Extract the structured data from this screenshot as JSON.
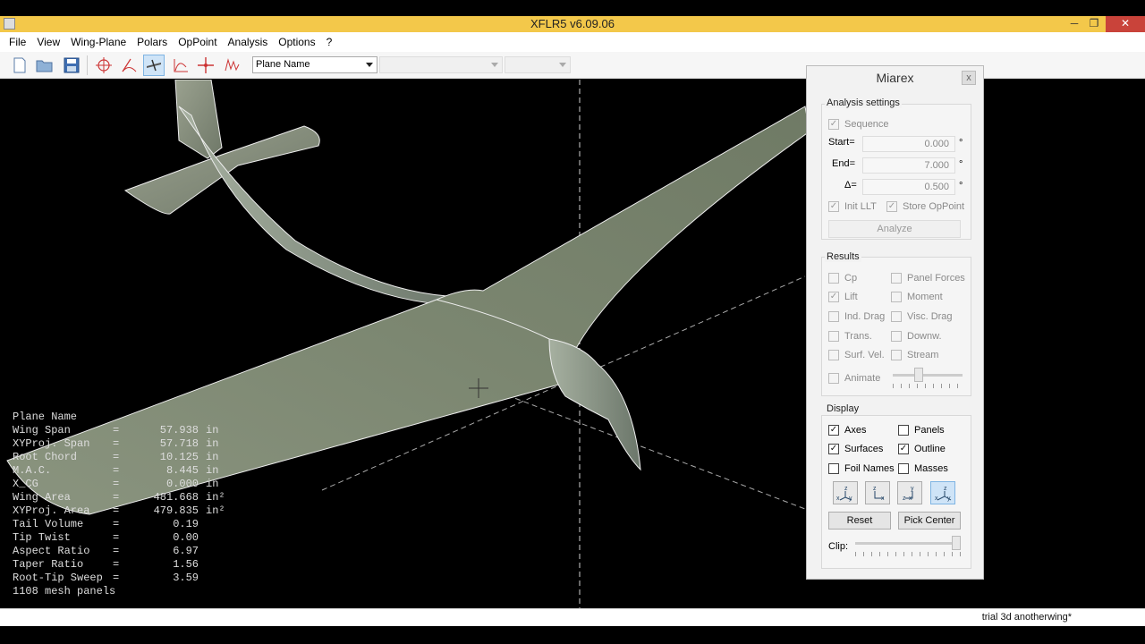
{
  "window": {
    "title": "XFLR5 v6.09.06",
    "min_glyph": "─",
    "max_glyph": "❐",
    "close_glyph": "✕"
  },
  "menu": [
    "File",
    "View",
    "Wing-Plane",
    "Polars",
    "OpPoint",
    "Analysis",
    "Options",
    "?"
  ],
  "toolbar": {
    "plane_combo": "Plane Name",
    "polar_combo": "",
    "opp_combo": ""
  },
  "plane_info": [
    {
      "key": "Plane Name",
      "eq": "",
      "val": "",
      "unit": ""
    },
    {
      "key": "Wing Span",
      "eq": "=",
      "val": "57.938",
      "unit": "in"
    },
    {
      "key": "XYProj. Span",
      "eq": "=",
      "val": "57.718",
      "unit": "in"
    },
    {
      "key": "Root Chord",
      "eq": "=",
      "val": "10.125",
      "unit": "in"
    },
    {
      "key": "M.A.C.",
      "eq": "=",
      "val": "8.445",
      "unit": "in"
    },
    {
      "key": "X_CG",
      "eq": "=",
      "val": "0.000",
      "unit": "in"
    },
    {
      "key": "Wing Area",
      "eq": "=",
      "val": "481.668",
      "unit": "in²"
    },
    {
      "key": "XYProj. Area",
      "eq": "=",
      "val": "479.835",
      "unit": "in²"
    },
    {
      "key": "Tail Volume",
      "eq": "=",
      "val": "0.19",
      "unit": ""
    },
    {
      "key": "Tip Twist",
      "eq": "=",
      "val": "0.00",
      "unit": ""
    },
    {
      "key": "Aspect Ratio",
      "eq": "=",
      "val": "6.97",
      "unit": ""
    },
    {
      "key": "Taper Ratio",
      "eq": "=",
      "val": "1.56",
      "unit": ""
    },
    {
      "key": "Root-Tip Sweep",
      "eq": "=",
      "val": "3.59",
      "unit": ""
    },
    {
      "key": "1108 mesh panels",
      "eq": "",
      "val": "",
      "unit": ""
    }
  ],
  "miarex": {
    "title": "Miarex",
    "close": "x",
    "analysis_settings": {
      "label": "Analysis settings",
      "sequence": "Sequence",
      "start_label": "Start=",
      "start_value": "0.000",
      "end_label": "End=",
      "end_value": "7.000",
      "delta_label": "Δ=",
      "delta_value": "0.500",
      "deg": "°",
      "init_llt": "Init LLT",
      "store_opp": "Store OpPoint",
      "analyze": "Analyze"
    },
    "results": {
      "label": "Results",
      "cp": "Cp",
      "panel_forces": "Panel Forces",
      "lift": "Lift",
      "moment": "Moment",
      "ind_drag": "Ind. Drag",
      "visc_drag": "Visc. Drag",
      "trans": "Trans.",
      "downw": "Downw.",
      "surf_vel": "Surf. Vel.",
      "stream": "Stream",
      "animate": "Animate"
    },
    "display": {
      "label": "Display",
      "axes": "Axes",
      "panels": "Panels",
      "surfaces": "Surfaces",
      "outline": "Outline",
      "foil_names": "Foil Names",
      "masses": "Masses",
      "reset": "Reset",
      "pick_center": "Pick Center",
      "clip": "Clip:"
    }
  },
  "status": "trial 3d anotherwing*",
  "colors": {
    "titlebar": "#f3c84a",
    "surface": "#7f8a75",
    "close_red": "#c9433a"
  }
}
